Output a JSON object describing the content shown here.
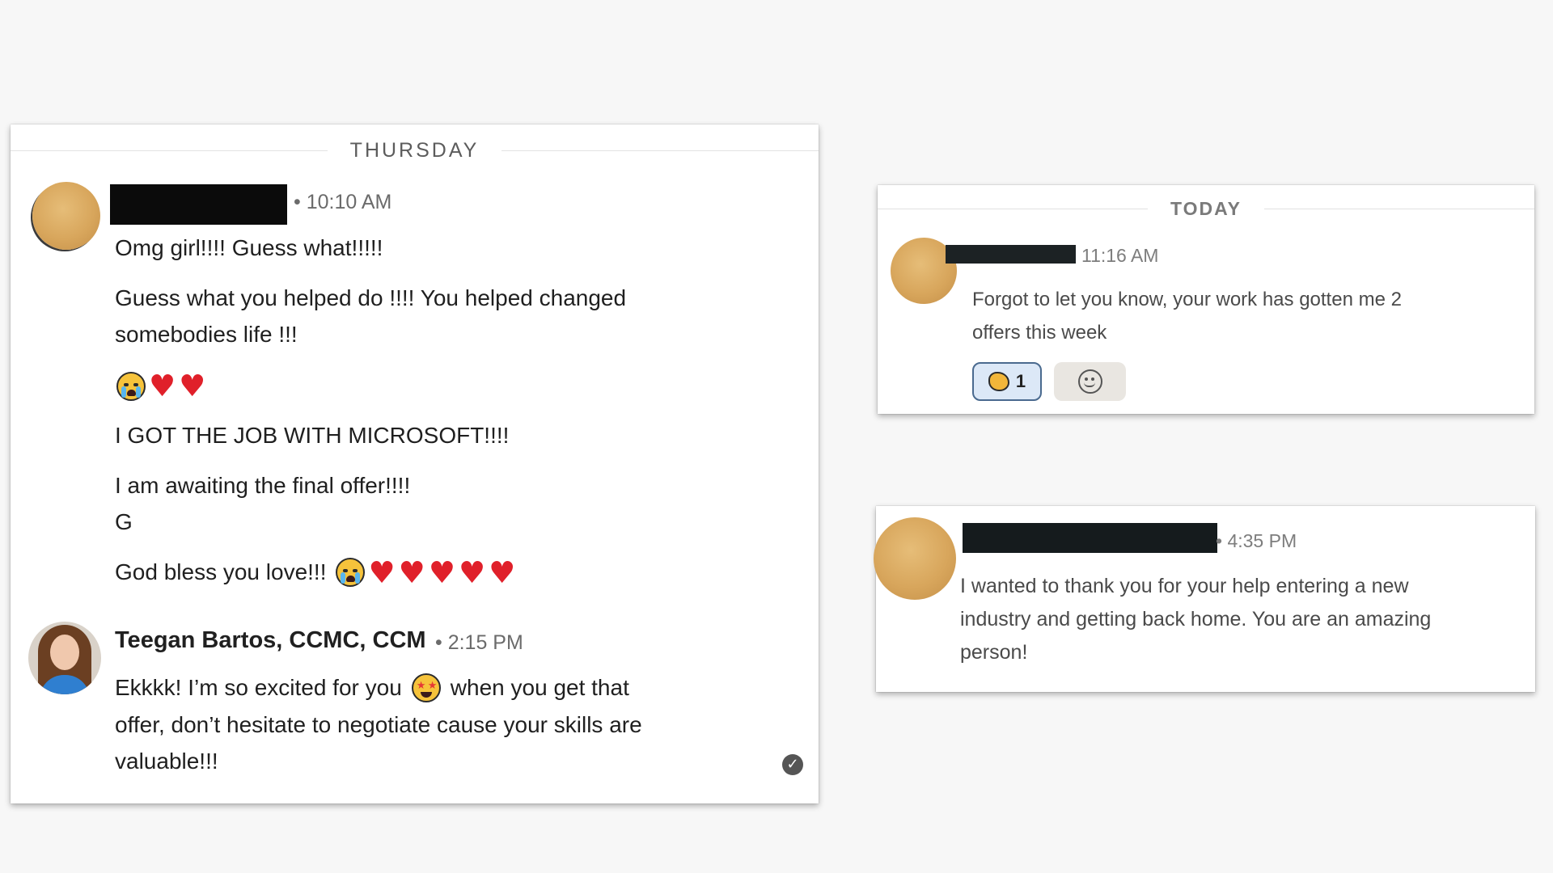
{
  "thread_thursday": {
    "day_label": "THURSDAY",
    "message_1": {
      "time": "• 10:10 AM",
      "lines": [
        "Omg girl!!!! Guess what!!!!!",
        "Guess what you helped do !!!! You helped changed",
        "somebodies life !!!",
        "I GOT THE JOB WITH MICROSOFT!!!!",
        "I am awaiting the final offer!!!!",
        "G",
        "God bless you love!!!"
      ]
    },
    "message_2": {
      "sender": "Teegan Bartos, CCMC, CCM",
      "time": "• 2:15 PM",
      "line_1_before": "Ekkkk! I’m so excited for you",
      "line_1_after": "when you get that",
      "line_2": "offer, don’t hesitate to negotiate cause your skills are",
      "line_3": "valuable!!!"
    },
    "read_receipt_icon": "check-circle-icon"
  },
  "thread_today": {
    "day_label": "TODAY",
    "message": {
      "time": "11:16 AM",
      "line_1": "Forgot to let you know, your work has gotten me 2",
      "line_2": "offers this week"
    },
    "reactions": {
      "clap_count": "1",
      "clap_icon": "clapping-hands-icon",
      "add_icon": "add-reaction-icon"
    }
  },
  "thread_late": {
    "message": {
      "time": "• 4:35 PM",
      "line_1": "I wanted to thank you for your help entering a new",
      "line_2": "industry and getting back home. You are an amazing",
      "line_3": "person!"
    }
  },
  "colors": {
    "background": "#f7f7f7",
    "heart": "#e0202a",
    "reaction_active_bg": "#dce8f7",
    "reaction_active_border": "#4a6a8f",
    "reaction_add_bg": "#e9e6e1"
  }
}
